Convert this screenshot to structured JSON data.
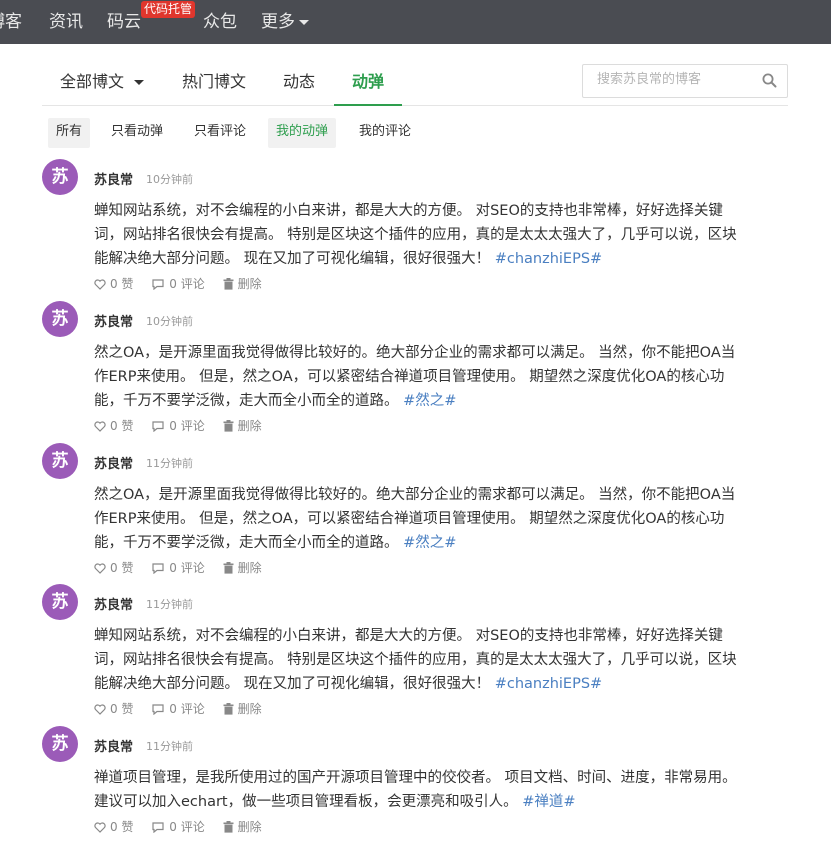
{
  "topnav": {
    "items": [
      "博客",
      "资讯",
      "码云",
      "众包",
      "更多"
    ],
    "badge": "代码托管"
  },
  "tabs": [
    "全部博文",
    "热门博文",
    "动态",
    "动弹"
  ],
  "search": {
    "placeholder": "搜索苏良常的博客"
  },
  "filters": [
    "所有",
    "只看动弹",
    "只看评论",
    "我的动弹",
    "我的评论"
  ],
  "posts": [
    {
      "avatar": "苏",
      "author": "苏良常",
      "time": "10分钟前",
      "lines": [
        "蝉知网站系统，对不会编程的小白来讲，都是大大的方便。 对SEO的支持也非常棒，好好选择关键",
        "词，网站排名很快会有提高。 特别是区块这个插件的应用，真的是太太太强大了，几乎可以说，区块",
        "能解决绝大部分问题。 现在又加了可视化编辑，很好很强大！ "
      ],
      "tag": "#chanzhiEPS#",
      "likes": "0 赞",
      "comments": "0 评论",
      "delete": "删除"
    },
    {
      "avatar": "苏",
      "author": "苏良常",
      "time": "10分钟前",
      "lines": [
        "然之OA，是开源里面我觉得做得比较好的。绝大部分企业的需求都可以满足。 当然，你不能把OA当",
        "作ERP来使用。 但是，然之OA，可以紧密结合禅道项目管理使用。 期望然之深度优化OA的核心功",
        "能，千万不要学泛微，走大而全小而全的道路。 "
      ],
      "tag": "#然之#",
      "likes": "0 赞",
      "comments": "0 评论",
      "delete": "删除"
    },
    {
      "avatar": "苏",
      "author": "苏良常",
      "time": "11分钟前",
      "lines": [
        "然之OA，是开源里面我觉得做得比较好的。绝大部分企业的需求都可以满足。 当然，你不能把OA当",
        "作ERP来使用。 但是，然之OA，可以紧密结合禅道项目管理使用。 期望然之深度优化OA的核心功",
        "能，千万不要学泛微，走大而全小而全的道路。 "
      ],
      "tag": "#然之#",
      "likes": "0 赞",
      "comments": "0 评论",
      "delete": "删除"
    },
    {
      "avatar": "苏",
      "author": "苏良常",
      "time": "11分钟前",
      "lines": [
        "蝉知网站系统，对不会编程的小白来讲，都是大大的方便。 对SEO的支持也非常棒，好好选择关键",
        "词，网站排名很快会有提高。 特别是区块这个插件的应用，真的是太太太强大了，几乎可以说，区块",
        "能解决绝大部分问题。 现在又加了可视化编辑，很好很强大！ "
      ],
      "tag": "#chanzhiEPS#",
      "likes": "0 赞",
      "comments": "0 评论",
      "delete": "删除"
    },
    {
      "avatar": "苏",
      "author": "苏良常",
      "time": "11分钟前",
      "lines": [
        "禅道项目管理，是我所使用过的国产开源项目管理中的佼佼者。 项目文档、时间、进度，非常易用。",
        "建议可以加入echart，做一些项目管理看板，会更漂亮和吸引人。 "
      ],
      "tag": "#禅道#",
      "likes": "0 赞",
      "comments": "0 评论",
      "delete": "删除"
    }
  ]
}
